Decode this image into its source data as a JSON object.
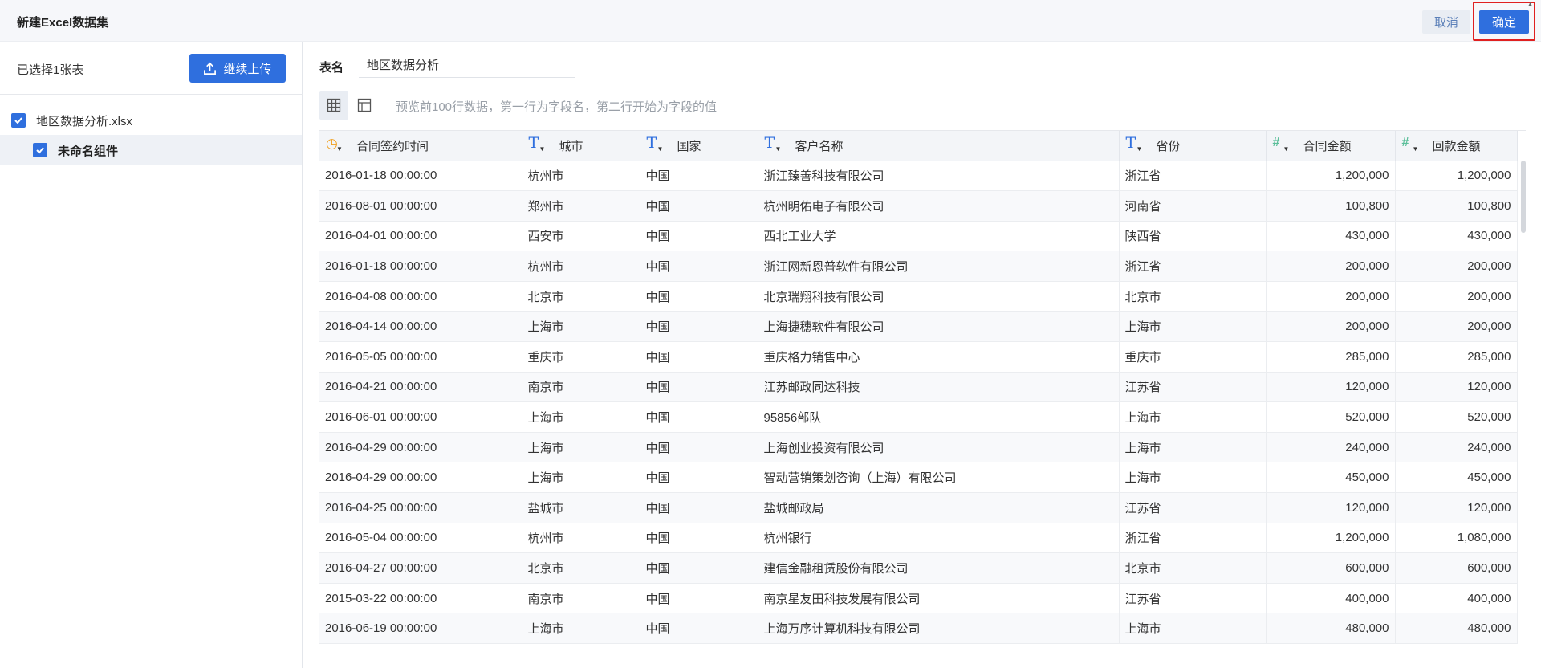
{
  "header": {
    "title": "新建Excel数据集",
    "cancel_label": "取消",
    "ok_label": "确定",
    "highlight_color": "#e02020"
  },
  "sidebar": {
    "selected_count": "已选择1张表",
    "upload_label": "继续上传",
    "file_name": "地区数据分析.xlsx",
    "component_name": "未命名组件"
  },
  "main": {
    "table_name_label": "表名",
    "table_name_value": "地区数据分析",
    "hint": "预览前100行数据，第一行为字段名，第二行开始为字段的值",
    "accent_color": "#2f6fde"
  },
  "table": {
    "columns": [
      {
        "label": "合同签约时间",
        "type_icon": "date-icon"
      },
      {
        "label": "城市",
        "type_icon": "text-type-icon"
      },
      {
        "label": "国家",
        "type_icon": "text-type-icon"
      },
      {
        "label": "客户名称",
        "type_icon": "text-type-icon"
      },
      {
        "label": "省份",
        "type_icon": "text-type-icon"
      },
      {
        "label": "合同金额",
        "type_icon": "number-type-icon"
      },
      {
        "label": "回款金额",
        "type_icon": "number-type-icon"
      }
    ],
    "rows": [
      [
        "2016-01-18 00:00:00",
        "杭州市",
        "中国",
        "浙江臻善科技有限公司",
        "浙江省",
        "1,200,000",
        "1,200,000"
      ],
      [
        "2016-08-01 00:00:00",
        "郑州市",
        "中国",
        "杭州明佑电子有限公司",
        "河南省",
        "100,800",
        "100,800"
      ],
      [
        "2016-04-01 00:00:00",
        "西安市",
        "中国",
        "西北工业大学",
        "陕西省",
        "430,000",
        "430,000"
      ],
      [
        "2016-01-18 00:00:00",
        "杭州市",
        "中国",
        "浙江网新恩普软件有限公司",
        "浙江省",
        "200,000",
        "200,000"
      ],
      [
        "2016-04-08 00:00:00",
        "北京市",
        "中国",
        "北京瑞翔科技有限公司",
        "北京市",
        "200,000",
        "200,000"
      ],
      [
        "2016-04-14 00:00:00",
        "上海市",
        "中国",
        "上海捷穗软件有限公司",
        "上海市",
        "200,000",
        "200,000"
      ],
      [
        "2016-05-05 00:00:00",
        "重庆市",
        "中国",
        "重庆格力销售中心",
        "重庆市",
        "285,000",
        "285,000"
      ],
      [
        "2016-04-21 00:00:00",
        "南京市",
        "中国",
        "江苏邮政同达科技",
        "江苏省",
        "120,000",
        "120,000"
      ],
      [
        "2016-06-01 00:00:00",
        "上海市",
        "中国",
        "95856部队",
        "上海市",
        "520,000",
        "520,000"
      ],
      [
        "2016-04-29 00:00:00",
        "上海市",
        "中国",
        "上海创业投资有限公司",
        "上海市",
        "240,000",
        "240,000"
      ],
      [
        "2016-04-29 00:00:00",
        "上海市",
        "中国",
        "智动营销策划咨询（上海）有限公司",
        "上海市",
        "450,000",
        "450,000"
      ],
      [
        "2016-04-25 00:00:00",
        "盐城市",
        "中国",
        "盐城邮政局",
        "江苏省",
        "120,000",
        "120,000"
      ],
      [
        "2016-05-04 00:00:00",
        "杭州市",
        "中国",
        "杭州银行",
        "浙江省",
        "1,200,000",
        "1,080,000"
      ],
      [
        "2016-04-27 00:00:00",
        "北京市",
        "中国",
        "建信金融租赁股份有限公司",
        "北京市",
        "600,000",
        "600,000"
      ],
      [
        "2015-03-22 00:00:00",
        "南京市",
        "中国",
        "南京星友田科技发展有限公司",
        "江苏省",
        "400,000",
        "400,000"
      ],
      [
        "2016-06-19 00:00:00",
        "上海市",
        "中国",
        "上海万序计算机科技有限公司",
        "上海市",
        "480,000",
        "480,000"
      ]
    ]
  }
}
